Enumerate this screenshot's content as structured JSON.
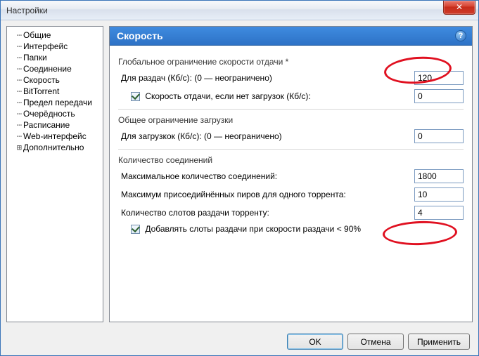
{
  "window": {
    "title": "Настройки"
  },
  "sidebar": {
    "items": [
      "Общие",
      "Интерфейс",
      "Папки",
      "Соединение",
      "Скорость",
      "BitTorrent",
      "Предел передачи",
      "Очерёдность",
      "Расписание",
      "Web-интерфейс"
    ],
    "expandable": "Дополнительно"
  },
  "panel": {
    "title": "Скорость",
    "help": "?",
    "section1": {
      "title": "Глобальное ограничение скорости отдачи *",
      "upload_label": "Для раздач (Кб/с): (0 — неограничено)",
      "upload_value": "120",
      "alt_check_label": "Скорость отдачи, если нет загрузок (Кб/с):",
      "alt_value": "0"
    },
    "section2": {
      "title": "Общее ограничение загрузки",
      "download_label": "Для загрузкок (Кб/с): (0 — неограничено)",
      "download_value": "0"
    },
    "section3": {
      "title": "Количество соединений",
      "max_conn_label": "Максимальное количество соединений:",
      "max_conn_value": "1800",
      "max_peers_label": "Максимум присоедийнённых пиров для одного торрента:",
      "max_peers_value": "10",
      "slots_label": "Количество слотов раздачи торренту:",
      "slots_value": "4",
      "extra_slots_label": "Добавлять слоты раздачи при скорости раздачи < 90%"
    }
  },
  "buttons": {
    "ok": "OK",
    "cancel": "Отмена",
    "apply": "Применить"
  }
}
